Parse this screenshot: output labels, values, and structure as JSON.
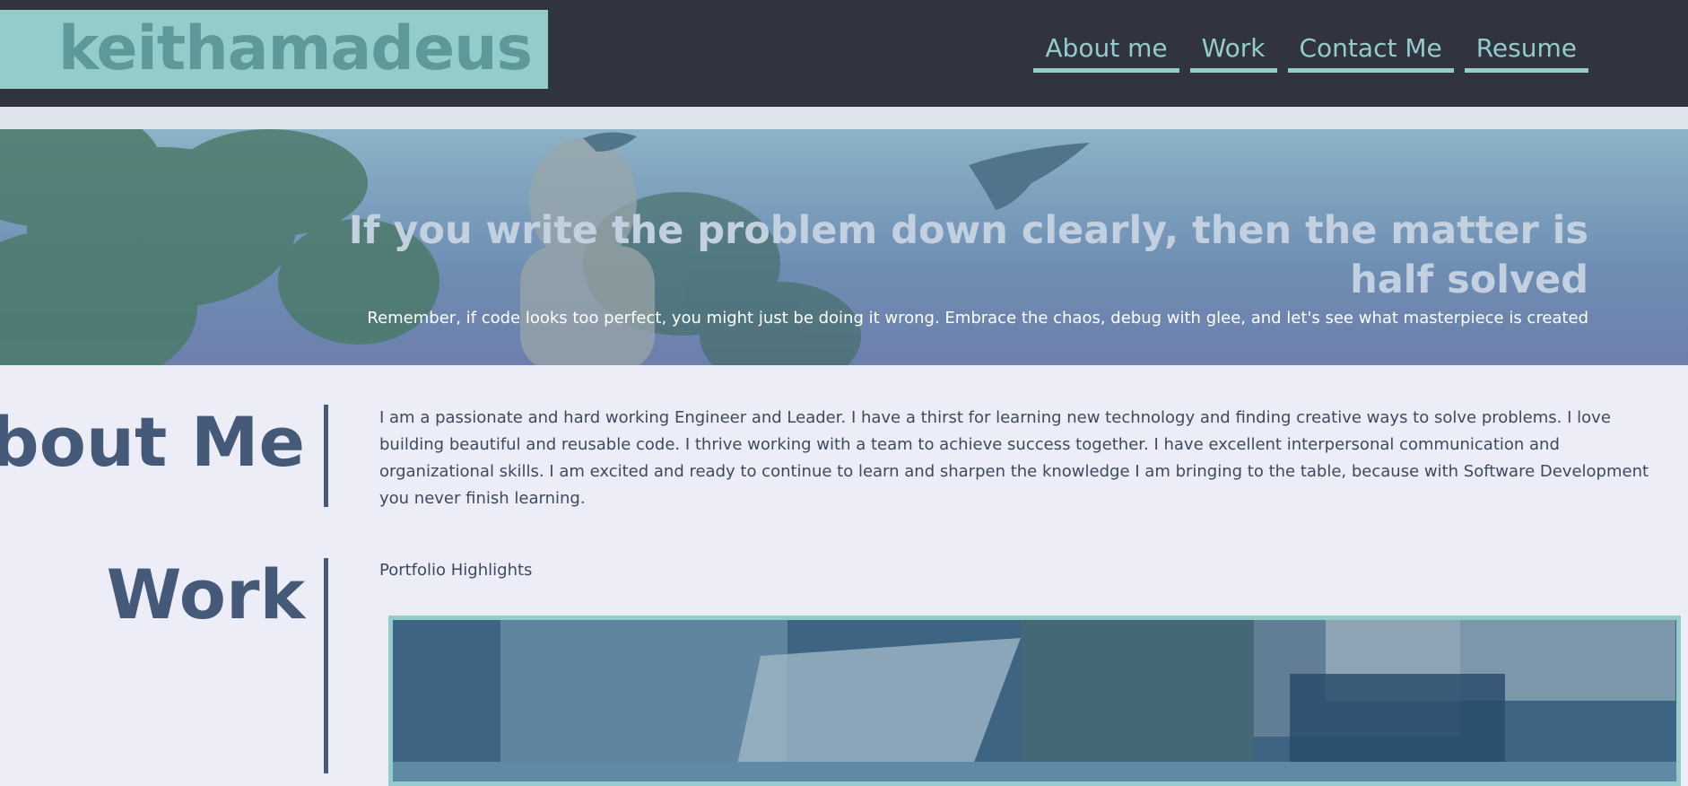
{
  "header": {
    "logo": "keithamadeus",
    "nav": [
      "About me",
      "Work",
      "Contact Me",
      "Resume"
    ]
  },
  "hero": {
    "quote": "If you write the problem down clearly, then the matter is half solved",
    "subtext": "Remember, if code looks too perfect, you might just be doing it wrong. Embrace the chaos, debug with glee, and let's see what masterpiece is created"
  },
  "about": {
    "heading": "About Me",
    "text": "I am a passionate and hard working Engineer and Leader. I have a thirst for learning new technology and finding creative ways to solve problems. I love building beautiful and reusable code. I thrive working with a team to achieve success together. I have excellent interpersonal communication and organizational skills. I am excited and ready to continue to learn and sharpen the knowledge I am bringing to the table, because with Software Development you never finish learning."
  },
  "work": {
    "heading": "Work",
    "subtitle": "Portfolio Highlights"
  },
  "colors": {
    "header_bg": "#31343e",
    "accent": "#94cbcb",
    "page_bg": "#ecedf6",
    "heading": "#455a79"
  }
}
